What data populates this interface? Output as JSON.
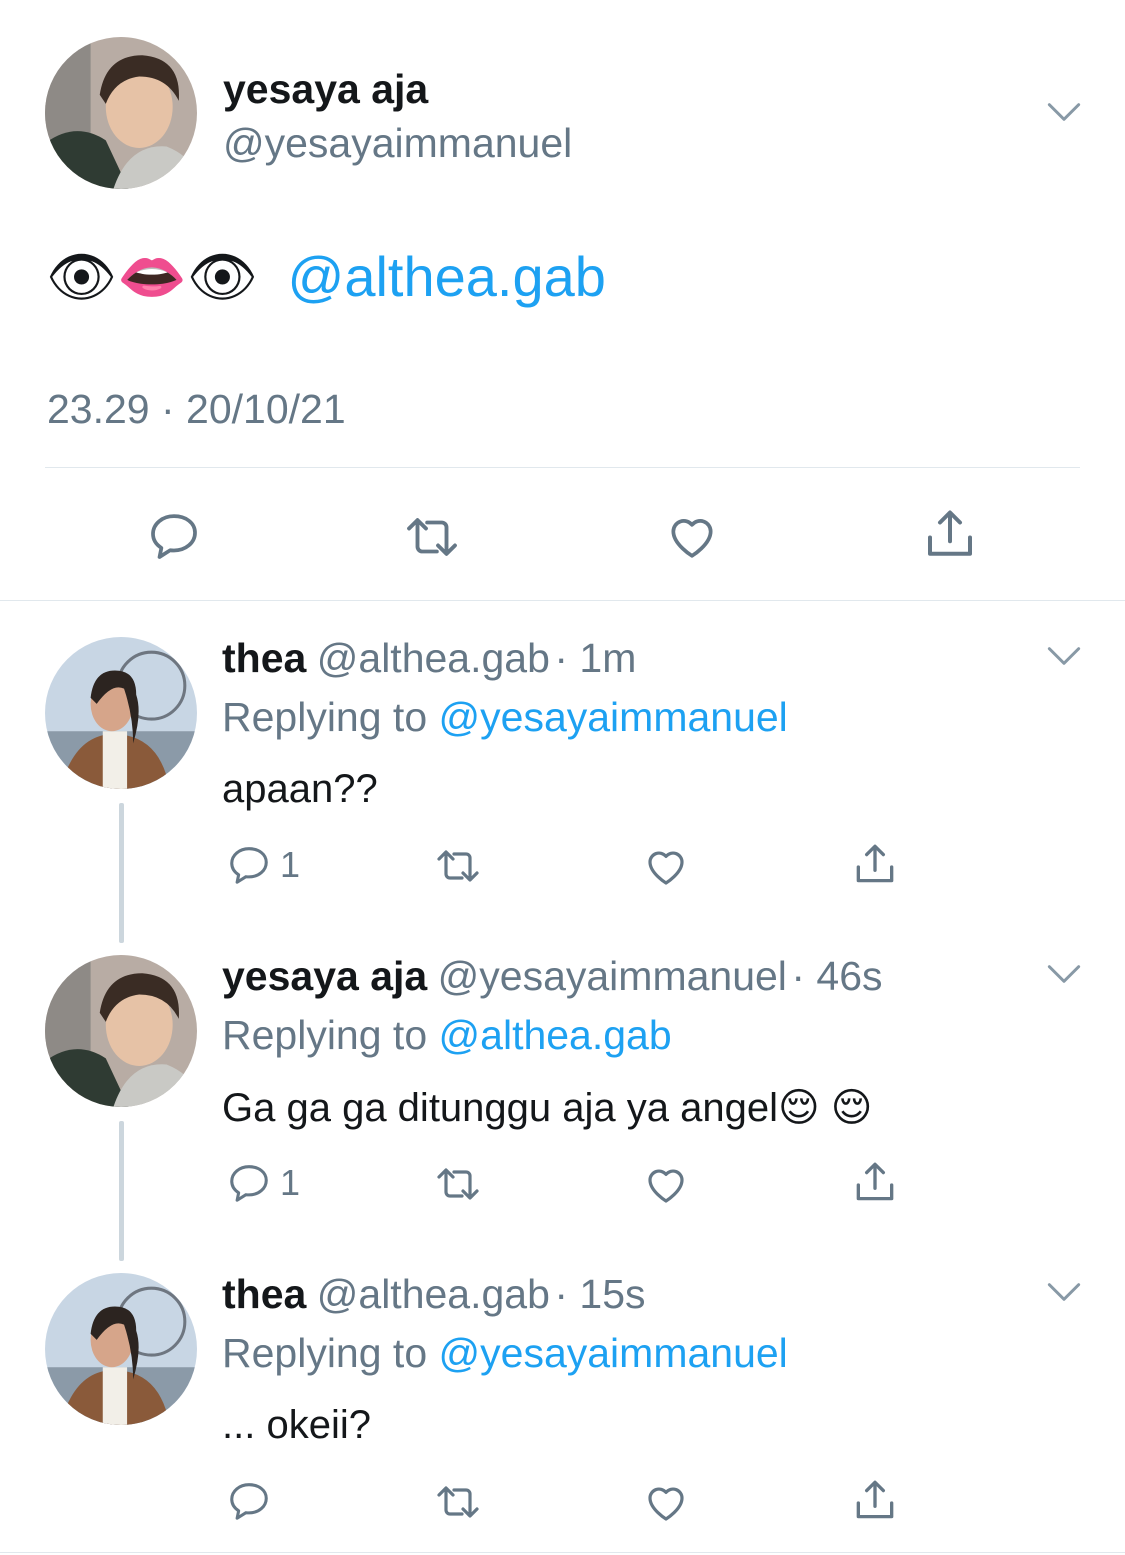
{
  "main_tweet": {
    "display_name": "yesaya aja",
    "handle": "@yesayaimmanuel",
    "emojis": "👁👄👁",
    "mention": "@althea.gab",
    "timestamp": "23.29 · 20/10/21"
  },
  "replies": [
    {
      "display_name": "thea",
      "handle": "@althea.gab",
      "time": "· 1m",
      "replying_prefix": "Replying to",
      "replying_to": "@yesayaimmanuel",
      "text": "apaan??",
      "reply_count": "1"
    },
    {
      "display_name": "yesaya aja",
      "handle": "@yesayaimmanuel",
      "time": "· 46s",
      "replying_prefix": "Replying to",
      "replying_to": "@althea.gab",
      "text": "Ga ga ga ditunggu aja ya angel😌 😌",
      "reply_count": "1"
    },
    {
      "display_name": "thea",
      "handle": "@althea.gab",
      "time": "· 15s",
      "replying_prefix": "Replying to",
      "replying_to": "@yesayaimmanuel",
      "text": "... okeii?",
      "reply_count": ""
    }
  ],
  "colors": {
    "link": "#1da1f2",
    "secondary_text": "#657786",
    "divider": "#e1e8ed",
    "thread_line": "#ccd6dd"
  },
  "icons": [
    "chevron-down-icon",
    "reply-icon",
    "retweet-icon",
    "like-icon",
    "share-icon"
  ]
}
